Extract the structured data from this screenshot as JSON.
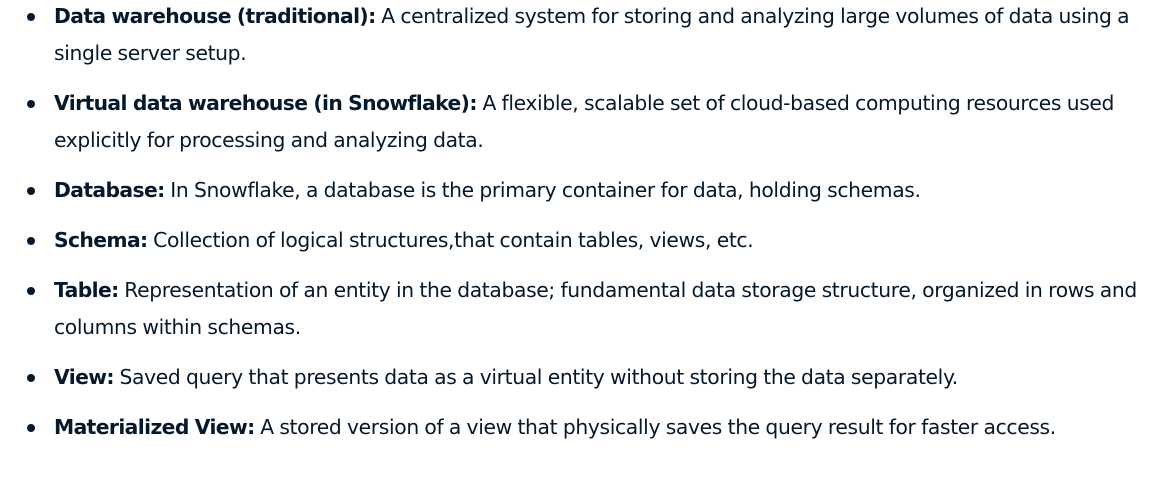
{
  "glossary": {
    "items": [
      {
        "term": "Data warehouse (traditional):",
        "definition": "A centralized system for storing and analyzing large volumes of data using a single server setup."
      },
      {
        "term": "Virtual data warehouse (in Snowflake):",
        "definition": "A flexible, scalable set of cloud-based computing resources used explicitly for processing and analyzing data."
      },
      {
        "term": "Database:",
        "definition": "In Snowflake, a database is the primary container for data, holding schemas."
      },
      {
        "term": "Schema:",
        "definition": "Collection of logical structures,that contain tables, views, etc."
      },
      {
        "term": "Table:",
        "definition": "Representation of an entity in the database; fundamental data storage structure, organized in rows and columns within schemas."
      },
      {
        "term": "View:",
        "definition": "Saved query that presents data as a virtual entity without storing the data separately."
      },
      {
        "term": "Materialized View:",
        "definition": "A stored version of a view that physically saves the query result for faster access."
      }
    ]
  }
}
